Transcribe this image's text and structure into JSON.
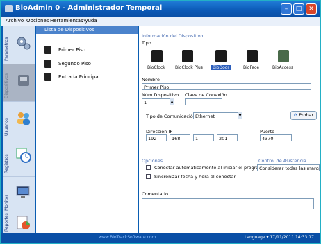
{
  "window": {
    "title": "BioAdmin 0 - Administrador Temporal"
  },
  "menu": [
    "Archivo",
    "Opciones",
    "Herramientas",
    "Ayuda"
  ],
  "sidebar": {
    "items": [
      {
        "label": "Parámetros"
      },
      {
        "label": "Dispositivos"
      },
      {
        "label": "Usuarios"
      },
      {
        "label": "Registros"
      },
      {
        "label": "Monitor"
      },
      {
        "label": "Reportes"
      }
    ]
  },
  "device_list": {
    "header": "Lista de Dispositivos",
    "items": [
      "Primer Piso",
      "Segundo Piso",
      "Entrada Principal"
    ]
  },
  "device_info": {
    "header": "Información del Dispositivo",
    "tipo_label": "Tipo",
    "types": [
      "BioClock",
      "BioClock Plus",
      "BioDoor",
      "BioFace",
      "BioAccess"
    ],
    "selected_type": "BioDoor",
    "nombre_label": "Nombre",
    "nombre_value": "Primer Piso",
    "num_label": "Núm Dispositivo",
    "num_value": "1",
    "clave_label": "Clave de Conexión",
    "clave_value": "",
    "com_label": "Tipo de Comunicación",
    "com_value": "Ethernet",
    "probar_label": "Probar",
    "ip_label": "Dirección IP",
    "ip": [
      "192",
      "168",
      "1",
      "201"
    ],
    "puerto_label": "Puerto",
    "puerto_value": "4370",
    "opciones_label": "Opciones",
    "opt1": "Conectar automáticamente al iniciar el programa",
    "opt2": "Sincronizar fecha y hora al conectar",
    "asistencia_label": "Control de Asistencia",
    "asistencia_value": "Considerar todas las marcas de e",
    "comentario_label": "Comentario",
    "comentario_value": ""
  },
  "status": {
    "link": "www.BioTrackSoftware.com",
    "language": "Language",
    "datetime": "17/11/2011 14:33:17"
  }
}
